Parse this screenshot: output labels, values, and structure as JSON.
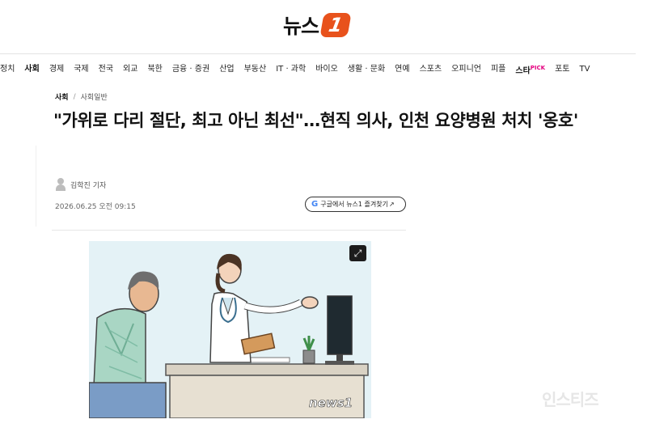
{
  "brand": {
    "logo_text": "뉴스",
    "logo_badge": "1",
    "accent": "#e8521c"
  },
  "nav": {
    "items": [
      {
        "label": "정치"
      },
      {
        "label": "사회",
        "active": true
      },
      {
        "label": "경제"
      },
      {
        "label": "국제"
      },
      {
        "label": "전국"
      },
      {
        "label": "외교"
      },
      {
        "label": "북한"
      },
      {
        "label": "금융 · 증권"
      },
      {
        "label": "산업"
      },
      {
        "label": "부동산"
      },
      {
        "label": "IT · 과학"
      },
      {
        "label": "바이오"
      },
      {
        "label": "생활 · 문화"
      },
      {
        "label": "연예"
      },
      {
        "label": "스포츠"
      },
      {
        "label": "오피니언"
      },
      {
        "label": "피플"
      },
      {
        "label": "스타",
        "suffix": "PICK"
      },
      {
        "label": "포토"
      },
      {
        "label": "TV"
      }
    ]
  },
  "breadcrumb": {
    "section": "사회",
    "separator": "/",
    "subsection": "사회일반"
  },
  "article": {
    "headline": "\"가위로 다리 절단, 최고 아닌 최선\"…현직 의사, 인천 요양병원 처치 '옹호'",
    "reporter": "김학진 기자",
    "date": "2026.06.25 오전 09:15",
    "google_button": {
      "icon": "G",
      "label": "구글에서 뉴스1 즐겨찾기",
      "arrow": "↗"
    }
  },
  "figure": {
    "icon": "expand-icon",
    "watermark_logo": "news1"
  },
  "site_watermark": "인스티즈"
}
